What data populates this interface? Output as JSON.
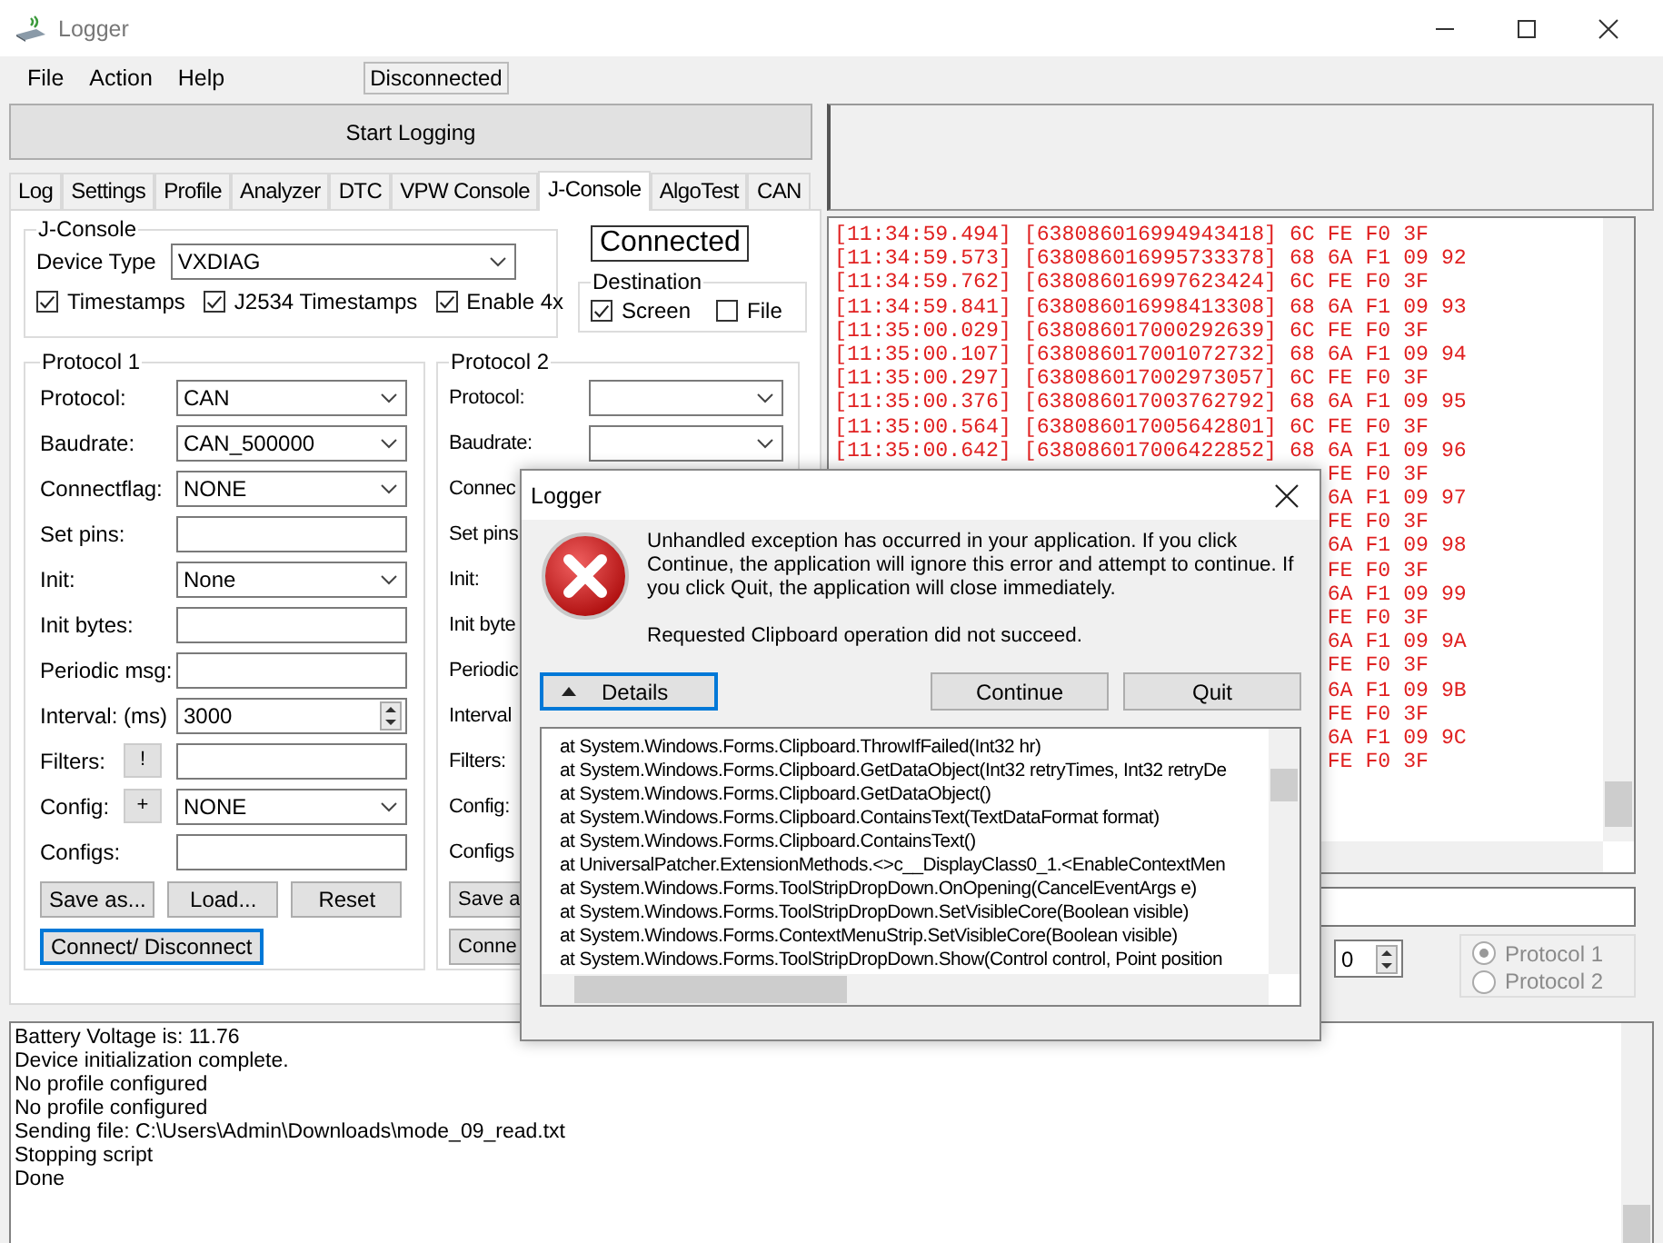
{
  "window": {
    "title": "Logger"
  },
  "menu": [
    "File",
    "Action",
    "Help"
  ],
  "status": "Disconnected",
  "start_button": "Start Logging",
  "tabs": [
    {
      "label": "Log",
      "selected": false
    },
    {
      "label": "Settings",
      "selected": false
    },
    {
      "label": "Profile",
      "selected": false
    },
    {
      "label": "Analyzer",
      "selected": false
    },
    {
      "label": "DTC",
      "selected": false
    },
    {
      "label": "VPW Console",
      "selected": false
    },
    {
      "label": "J-Console",
      "selected": true
    },
    {
      "label": "AlgoTest",
      "selected": false
    },
    {
      "label": "CAN",
      "selected": false
    }
  ],
  "jconsole": {
    "title": "J-Console",
    "device_type_label": "Device Type",
    "device_type": "VXDIAG",
    "options": [
      {
        "label": "Timestamps",
        "checked": true
      },
      {
        "label": "J2534 Timestamps",
        "checked": true
      },
      {
        "label": "Enable 4x",
        "checked": true
      }
    ]
  },
  "connection_state": "Connected",
  "destination": {
    "title": "Destination",
    "options": [
      {
        "label": "Screen",
        "checked": true
      },
      {
        "label": "File",
        "checked": false
      }
    ]
  },
  "protocol1": {
    "title": "Protocol 1",
    "fields": [
      {
        "label": "Protocol:",
        "kind": "combo",
        "value": "CAN"
      },
      {
        "label": "Baudrate:",
        "kind": "combo",
        "value": "CAN_500000"
      },
      {
        "label": "Connectflag:",
        "kind": "combo",
        "value": "NONE"
      },
      {
        "label": "Set pins:",
        "kind": "text"
      },
      {
        "label": "Init:",
        "kind": "combo",
        "value": "None"
      },
      {
        "label": "Init bytes:",
        "kind": "text"
      },
      {
        "label": "Periodic msg:",
        "kind": "text"
      },
      {
        "label": "Interval: (ms)",
        "kind": "spin",
        "value": "3000"
      },
      {
        "label": "Filters:",
        "kind": "button-text",
        "button": "!"
      },
      {
        "label": "Config:",
        "kind": "button-combo",
        "button": "+",
        "value": "NONE"
      },
      {
        "label": "Configs:",
        "kind": "text"
      }
    ],
    "buttons": [
      "Save as...",
      "Load...",
      "Reset"
    ],
    "connect_button": "Connect/ Disconnect"
  },
  "protocol2": {
    "title": "Protocol 2",
    "fields": [
      {
        "label": "Protocol:",
        "kind": "combo"
      },
      {
        "label": "Baudrate:",
        "kind": "combo"
      },
      {
        "label": "Connec",
        "kind": "covered"
      },
      {
        "label": "Set pins",
        "kind": "covered"
      },
      {
        "label": "Init:",
        "kind": "covered"
      },
      {
        "label": "Init byte",
        "kind": "covered"
      },
      {
        "label": "Periodic",
        "kind": "covered"
      },
      {
        "label": "Interval",
        "kind": "covered"
      },
      {
        "label": "Filters:",
        "kind": "covered"
      },
      {
        "label": "Config:",
        "kind": "covered"
      },
      {
        "label": "Configs",
        "kind": "covered"
      }
    ],
    "buttons": [
      "Save a"
    ],
    "connect_button": "Conne"
  },
  "trace": [
    {
      "kind": "full",
      "text": "[11:34:59.494] [638086016994943418] 6C FE F0 3F"
    },
    {
      "kind": "full",
      "text": "[11:34:59.573] [638086016995733378] 68 6A F1 09 92"
    },
    {
      "kind": "full",
      "text": "[11:34:59.762] [638086016997623424] 6C FE F0 3F"
    },
    {
      "kind": "full",
      "text": "[11:34:59.841] [638086016998413308] 68 6A F1 09 93"
    },
    {
      "kind": "full",
      "text": "[11:35:00.029] [638086017000292639] 6C FE F0 3F"
    },
    {
      "kind": "full",
      "text": "[11:35:00.107] [638086017001072732] 68 6A F1 09 94"
    },
    {
      "kind": "full",
      "text": "[11:35:00.297] [638086017002973057] 6C FE F0 3F"
    },
    {
      "kind": "full",
      "text": "[11:35:00.376] [638086017003762792] 68 6A F1 09 95"
    },
    {
      "kind": "full",
      "text": "[11:35:00.564] [638086017005642801] 6C FE F0 3F"
    },
    {
      "kind": "full",
      "text": "[11:35:00.642] [638086017006422852] 68 6A F1 09 96"
    },
    {
      "kind": "tail",
      "text": "FE F0 3F"
    },
    {
      "kind": "tail",
      "text": "6A F1 09 97"
    },
    {
      "kind": "tail",
      "text": "FE F0 3F"
    },
    {
      "kind": "tail",
      "text": "6A F1 09 98"
    },
    {
      "kind": "tail",
      "text": "FE F0 3F"
    },
    {
      "kind": "tail",
      "text": "6A F1 09 99"
    },
    {
      "kind": "tail",
      "text": "FE F0 3F"
    },
    {
      "kind": "tail",
      "text": "6A F1 09 9A"
    },
    {
      "kind": "tail",
      "text": "FE F0 3F"
    },
    {
      "kind": "tail",
      "text": "6A F1 09 9B"
    },
    {
      "kind": "tail",
      "text": "FE F0 3F"
    },
    {
      "kind": "tail",
      "text": "6A F1 09 9C"
    },
    {
      "kind": "tail",
      "text": "FE F0 3F"
    }
  ],
  "channel_value": "0",
  "protocol_choice": {
    "disabled": true,
    "options": [
      {
        "label": "Protocol 1",
        "selected": true
      },
      {
        "label": "Protocol 2",
        "selected": false
      }
    ]
  },
  "messages": [
    "Battery Voltage is: 11.76",
    "Device initialization complete.",
    "No profile configured",
    "No profile configured",
    "Sending file: C:\\Users\\Admin\\Downloads\\mode_09_read.txt",
    "Stopping script",
    "Done"
  ],
  "dialog": {
    "title": "Logger",
    "message": "Unhandled exception has occurred in your application. If you click Continue, the application will ignore this error and attempt to continue. If you click Quit, the application will close immediately.",
    "error": "Requested Clipboard operation did not succeed.",
    "details_button": "Details",
    "buttons": [
      "Continue",
      "Quit"
    ],
    "details": [
      "at System.Windows.Forms.Clipboard.ThrowIfFailed(Int32 hr)",
      "at System.Windows.Forms.Clipboard.GetDataObject(Int32 retryTimes, Int32 retryDe",
      "at System.Windows.Forms.Clipboard.GetDataObject()",
      "at System.Windows.Forms.Clipboard.ContainsText(TextDataFormat format)",
      "at System.Windows.Forms.Clipboard.ContainsText()",
      "at UniversalPatcher.ExtensionMethods.<>c__DisplayClass0_1.<EnableContextMen",
      "at System.Windows.Forms.ToolStripDropDown.OnOpening(CancelEventArgs e)",
      "at System.Windows.Forms.ToolStripDropDown.SetVisibleCore(Boolean visible)",
      "at System.Windows.Forms.ContextMenuStrip.SetVisibleCore(Boolean visible)",
      "at System.Windows.Forms.ToolStripDropDown.Show(Control control, Point position"
    ]
  }
}
